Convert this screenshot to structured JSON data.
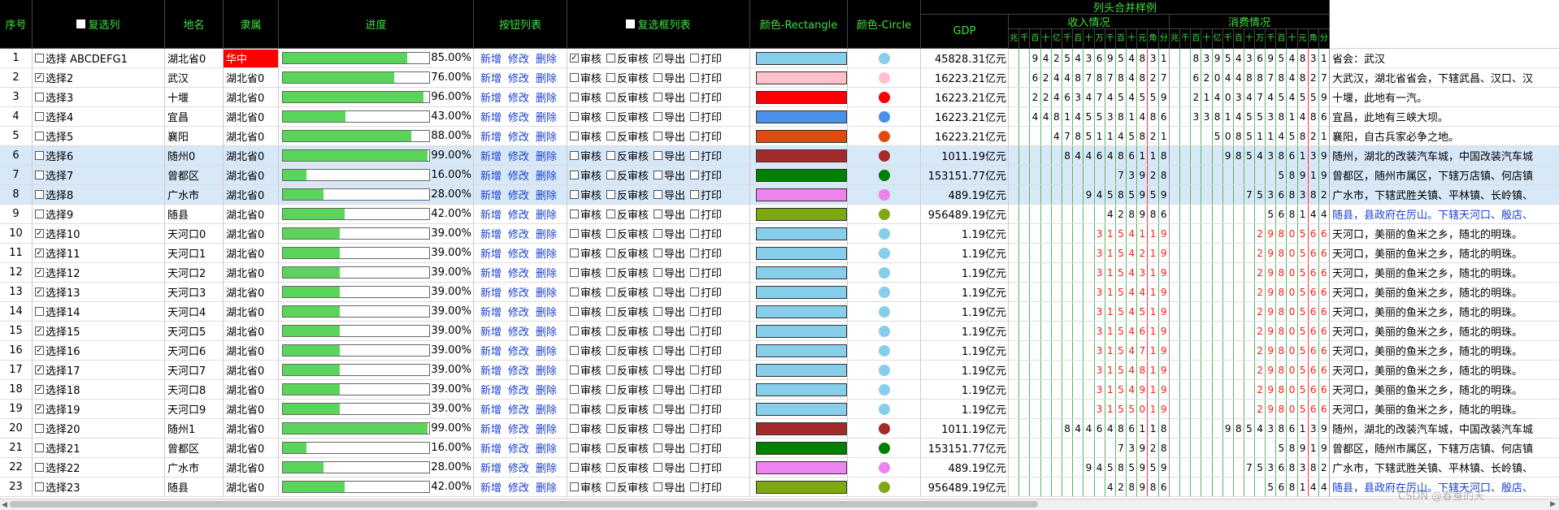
{
  "headers": {
    "seq": "序号",
    "checkcol": "复选列",
    "name": "地名",
    "belong": "隶属",
    "progress": "进度",
    "buttons": "按钮列表",
    "checklist": "复选框列表",
    "rect": "颜色-Rectangle",
    "circle": "颜色-Circle",
    "merge_title": "列头合并样例",
    "gdp": "GDP",
    "income": "收入情况",
    "consume": "消费情况",
    "digit_units": [
      "兆",
      "千",
      "百",
      "十",
      "亿",
      "千",
      "百",
      "十",
      "万",
      "千",
      "百",
      "十",
      "元",
      "角",
      "分"
    ]
  },
  "labels": {
    "add": "新增",
    "edit": "修改",
    "del": "删除",
    "audit": "审核",
    "unaudit": "反审核",
    "export": "导出",
    "print": "打印"
  },
  "watermark": "CSDN @春蚕的天",
  "rows": [
    {
      "n": "1",
      "check": false,
      "label": "选择  ABCDEFG1",
      "name": "湖北省0",
      "belong": "华中",
      "belong_red": true,
      "pct": 0.85,
      "pct_text": "85.00%",
      "cb": [
        true,
        false,
        true,
        false
      ],
      "color": "#87ceeb",
      "gdp": "45828.31亿元",
      "inc": "942543695483 1",
      "con": "839543695483 1",
      "desc": "省会：武汉",
      "sel": false,
      "desc_blue": false
    },
    {
      "n": "2",
      "check": true,
      "label": "选择2",
      "name": "武汉",
      "belong": "湖北省0",
      "pct": 0.76,
      "pct_text": "76.00%",
      "cb": [
        false,
        false,
        false,
        false
      ],
      "color": "#ffc0cb",
      "gdp": "16223.21亿元",
      "inc": "624487878482 7",
      "con": "620448878482 7",
      "desc": "大武汉，湖北省省会，下辖武昌、汉口、汉",
      "sel": false
    },
    {
      "n": "3",
      "check": false,
      "label": "选择3",
      "name": "十堰",
      "belong": "湖北省0",
      "pct": 0.96,
      "pct_text": "96.00%",
      "cb": [
        false,
        false,
        false,
        false
      ],
      "color": "#ff0000",
      "gdp": "16223.21亿元",
      "inc": "2246347454559",
      "con": "2140347454559",
      "desc": "十堰，此地有一汽。",
      "sel": false
    },
    {
      "n": "4",
      "check": false,
      "label": "选择4",
      "name": "宜昌",
      "belong": "湖北省0",
      "pct": 0.43,
      "pct_text": "43.00%",
      "cb": [
        false,
        false,
        false,
        false
      ],
      "color": "#4a90e8",
      "gdp": "16223.21亿元",
      "inc": "4481455381486",
      "con": "3381455381486",
      "desc": "宜昌，此地有三峡大坝。",
      "sel": false
    },
    {
      "n": "5",
      "check": false,
      "label": "选择5",
      "name": "襄阳",
      "belong": "湖北省0",
      "pct": 0.88,
      "pct_text": "88.00%",
      "cb": [
        false,
        false,
        false,
        false
      ],
      "color": "#e04a10",
      "gdp": "16223.21亿元",
      "inc": "47851145821",
      "con": "50851145821",
      "desc": "襄阳，自古兵家必争之地。",
      "sel": false
    },
    {
      "n": "6",
      "check": false,
      "label": "选择6",
      "name": "随州0",
      "belong": "湖北省0",
      "pct": 0.99,
      "pct_text": "99.00%",
      "cb": [
        false,
        false,
        false,
        false
      ],
      "color": "#a52a2a",
      "gdp": "1011.19亿元",
      "inc": "844648611 8",
      "con": "985438613 9",
      "desc": "随州，湖北的改装汽车城，中国改装汽车城",
      "sel": true
    },
    {
      "n": "7",
      "check": false,
      "label": "选择7",
      "name": "曾都区",
      "belong": "湖北省0",
      "pct": 0.16,
      "pct_text": "16.00%",
      "cb": [
        false,
        false,
        false,
        false
      ],
      "color": "#008000",
      "gdp": "153151.77亿元",
      "inc": "73928",
      "con": "58919",
      "desc": "曾都区，随州市属区，下辖万店镇、何店镇",
      "sel": true
    },
    {
      "n": "8",
      "check": false,
      "label": "选择8",
      "name": "广水市",
      "belong": "湖北省0",
      "pct": 0.28,
      "pct_text": "28.00%",
      "cb": [
        false,
        false,
        false,
        false
      ],
      "color": "#ee82ee",
      "gdp": "489.19亿元",
      "inc": "94585959",
      "con": "75368382",
      "desc": "广水市，下辖武胜关镇、平林镇、长岭镇、",
      "sel": true
    },
    {
      "n": "9",
      "check": false,
      "label": "选择9",
      "name": "随县",
      "belong": "湖北省0",
      "pct": 0.42,
      "pct_text": "42.00%",
      "cb": [
        false,
        false,
        false,
        false
      ],
      "color": "#7ea812",
      "gdp": "956489.19亿元",
      "inc": "428986",
      "con": "568144",
      "desc": "随县，县政府在厉山。下辖天河口、殷店、",
      "sel": false,
      "desc_blue": true
    },
    {
      "n": "10",
      "check": true,
      "label": "选择10",
      "name": "天河口0",
      "belong": "湖北省0",
      "pct": 0.39,
      "pct_text": "39.00%",
      "cb": [
        false,
        false,
        false,
        false
      ],
      "color": "#87ceeb",
      "gdp": "1.19亿元",
      "inc": "315411 9",
      "con": "298056 6",
      "red": true,
      "desc": "天河口，美丽的鱼米之乡，随北的明珠。",
      "sel": false
    },
    {
      "n": "11",
      "check": true,
      "label": "选择11",
      "name": "天河口1",
      "belong": "湖北省0",
      "pct": 0.39,
      "pct_text": "39.00%",
      "cb": [
        false,
        false,
        false,
        false
      ],
      "color": "#87ceeb",
      "gdp": "1.19亿元",
      "inc": "315421 9",
      "con": "298056 6",
      "red": true,
      "desc": "天河口，美丽的鱼米之乡，随北的明珠。",
      "sel": false
    },
    {
      "n": "12",
      "check": true,
      "label": "选择12",
      "name": "天河口2",
      "belong": "湖北省0",
      "pct": 0.39,
      "pct_text": "39.00%",
      "cb": [
        false,
        false,
        false,
        false
      ],
      "color": "#87ceeb",
      "gdp": "1.19亿元",
      "inc": "315431 9",
      "con": "298056 6",
      "red": true,
      "desc": "天河口，美丽的鱼米之乡，随北的明珠。",
      "sel": false
    },
    {
      "n": "13",
      "check": true,
      "label": "选择13",
      "name": "天河口3",
      "belong": "湖北省0",
      "pct": 0.39,
      "pct_text": "39.00%",
      "cb": [
        false,
        false,
        false,
        false
      ],
      "color": "#87ceeb",
      "gdp": "1.19亿元",
      "inc": "315441 9",
      "con": "298056 6",
      "red": true,
      "desc": "天河口，美丽的鱼米之乡，随北的明珠。",
      "sel": false
    },
    {
      "n": "14",
      "check": false,
      "label": "选择14",
      "name": "天河口4",
      "belong": "湖北省0",
      "pct": 0.39,
      "pct_text": "39.00%",
      "cb": [
        false,
        false,
        false,
        false
      ],
      "color": "#87ceeb",
      "gdp": "1.19亿元",
      "inc": "315451 9",
      "con": "298056 6",
      "red": true,
      "desc": "天河口，美丽的鱼米之乡，随北的明珠。",
      "sel": false
    },
    {
      "n": "15",
      "check": true,
      "label": "选择15",
      "name": "天河口5",
      "belong": "湖北省0",
      "pct": 0.39,
      "pct_text": "39.00%",
      "cb": [
        false,
        false,
        false,
        false
      ],
      "color": "#87ceeb",
      "gdp": "1.19亿元",
      "inc": "315461 9",
      "con": "298056 6",
      "red": true,
      "desc": "天河口，美丽的鱼米之乡，随北的明珠。",
      "sel": false
    },
    {
      "n": "16",
      "check": true,
      "label": "选择16",
      "name": "天河口6",
      "belong": "湖北省0",
      "pct": 0.39,
      "pct_text": "39.00%",
      "cb": [
        false,
        false,
        false,
        false
      ],
      "color": "#87ceeb",
      "gdp": "1.19亿元",
      "inc": "315471 9",
      "con": "298056 6",
      "red": true,
      "desc": "天河口，美丽的鱼米之乡，随北的明珠。",
      "sel": false
    },
    {
      "n": "17",
      "check": true,
      "label": "选择17",
      "name": "天河口7",
      "belong": "湖北省0",
      "pct": 0.39,
      "pct_text": "39.00%",
      "cb": [
        false,
        false,
        false,
        false
      ],
      "color": "#87ceeb",
      "gdp": "1.19亿元",
      "inc": "315481 9",
      "con": "298056 6",
      "red": true,
      "desc": "天河口，美丽的鱼米之乡，随北的明珠。",
      "sel": false
    },
    {
      "n": "18",
      "check": true,
      "label": "选择18",
      "name": "天河口8",
      "belong": "湖北省0",
      "pct": 0.39,
      "pct_text": "39.00%",
      "cb": [
        false,
        false,
        false,
        false
      ],
      "color": "#87ceeb",
      "gdp": "1.19亿元",
      "inc": "315491 9",
      "con": "298056 6",
      "red": true,
      "desc": "天河口，美丽的鱼米之乡，随北的明珠。",
      "sel": false
    },
    {
      "n": "19",
      "check": true,
      "label": "选择19",
      "name": "天河口9",
      "belong": "湖北省0",
      "pct": 0.39,
      "pct_text": "39.00%",
      "cb": [
        false,
        false,
        false,
        false
      ],
      "color": "#87ceeb",
      "gdp": "1.19亿元",
      "inc": "315501 9",
      "con": "298056 6",
      "red": true,
      "desc": "天河口，美丽的鱼米之乡，随北的明珠。",
      "sel": false
    },
    {
      "n": "20",
      "check": false,
      "label": "选择20",
      "name": "随州1",
      "belong": "湖北省0",
      "pct": 0.99,
      "pct_text": "99.00%",
      "cb": [
        false,
        false,
        false,
        false
      ],
      "color": "#a52a2a",
      "gdp": "1011.19亿元",
      "inc": "844648611 8",
      "con": "985438613 9",
      "desc": "随州，湖北的改装汽车城，中国改装汽车城",
      "sel": false
    },
    {
      "n": "21",
      "check": false,
      "label": "选择21",
      "name": "曾都区",
      "belong": "湖北省0",
      "pct": 0.16,
      "pct_text": "16.00%",
      "cb": [
        false,
        false,
        false,
        false
      ],
      "color": "#008000",
      "gdp": "153151.77亿元",
      "inc": "73928",
      "con": "58919",
      "desc": "曾都区，随州市属区，下辖万店镇、何店镇",
      "sel": false
    },
    {
      "n": "22",
      "check": false,
      "label": "选择22",
      "name": "广水市",
      "belong": "湖北省0",
      "pct": 0.28,
      "pct_text": "28.00%",
      "cb": [
        false,
        false,
        false,
        false
      ],
      "color": "#ee82ee",
      "gdp": "489.19亿元",
      "inc": "94585959",
      "con": "75368382",
      "desc": "广水市，下辖武胜关镇、平林镇、长岭镇、",
      "sel": false
    },
    {
      "n": "23",
      "check": false,
      "label": "选择23",
      "name": "随县",
      "belong": "湖北省0",
      "pct": 0.42,
      "pct_text": "42.00%",
      "cb": [
        false,
        false,
        false,
        false
      ],
      "color": "#7ea812",
      "gdp": "956489.19亿元",
      "inc": "428986",
      "con": "568144",
      "desc": "随县，县政府在厉山。下辖天河口、殷店、",
      "sel": false,
      "desc_blue": true
    }
  ]
}
